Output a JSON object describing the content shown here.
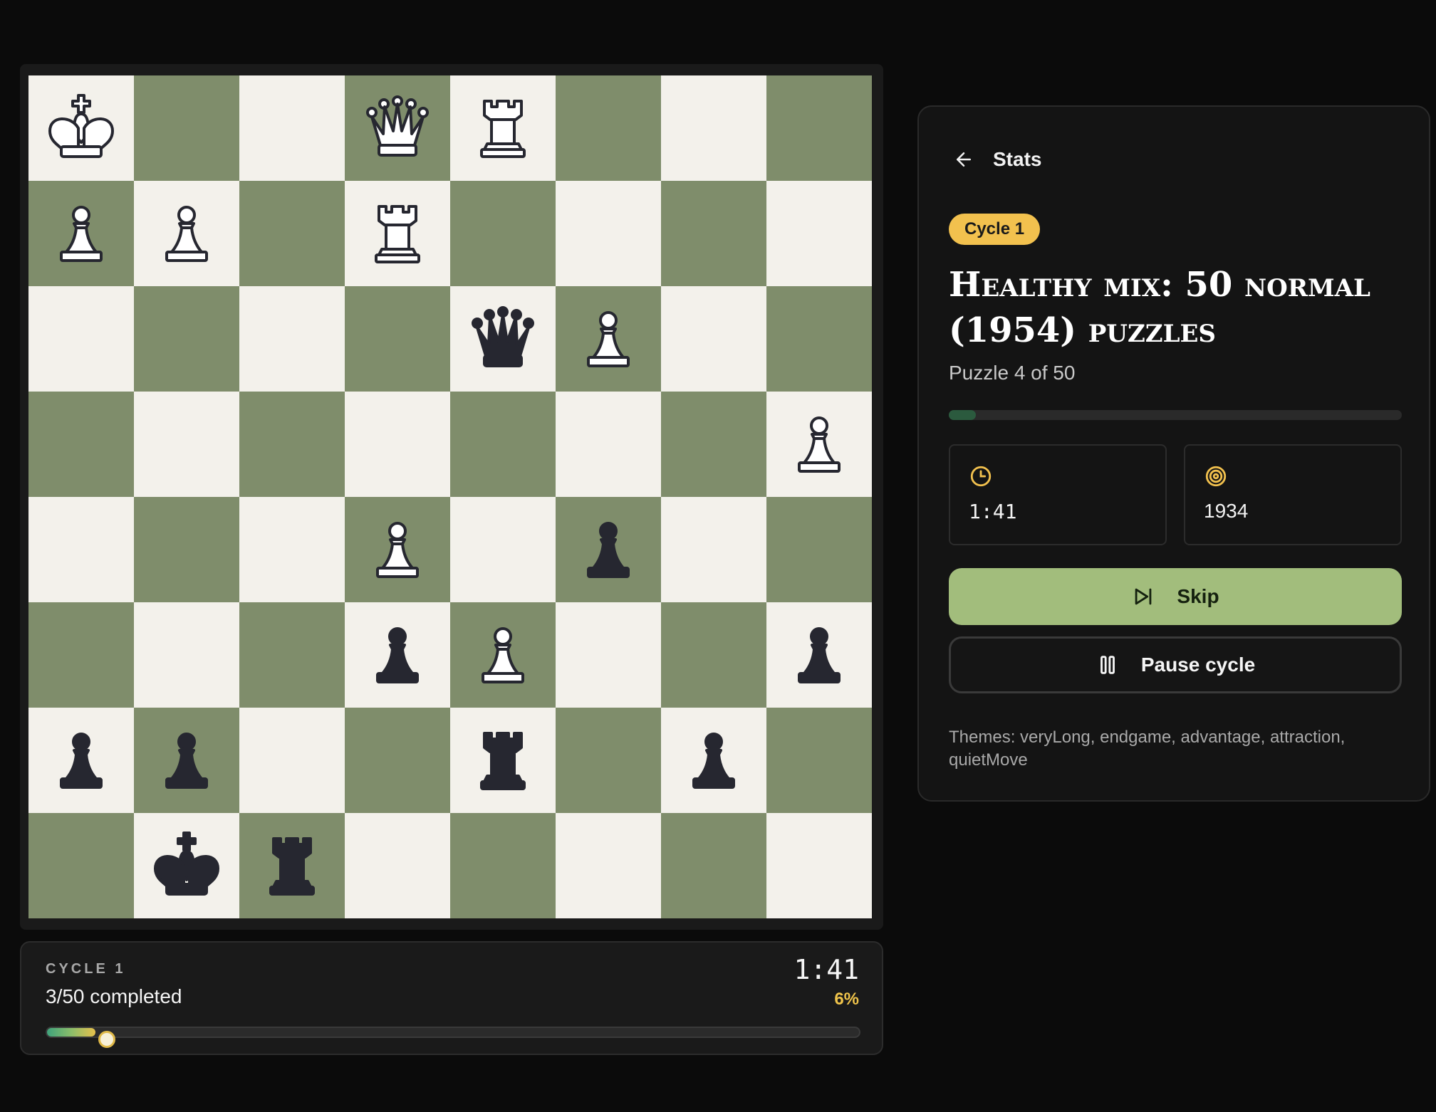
{
  "board": {
    "ranks": [
      [
        "wK",
        "",
        "",
        "wQ",
        "wR",
        "",
        "",
        ""
      ],
      [
        "wP",
        "wP",
        "",
        "wR",
        "",
        "",
        "",
        ""
      ],
      [
        "",
        "",
        "",
        "",
        "bQ",
        "wP",
        "",
        ""
      ],
      [
        "",
        "",
        "",
        "",
        "",
        "",
        "",
        "wP"
      ],
      [
        "",
        "",
        "",
        "wP",
        "",
        "bP",
        "",
        ""
      ],
      [
        "",
        "",
        "",
        "bP",
        "wP",
        "",
        "",
        "bP"
      ],
      [
        "bP",
        "bP",
        "",
        "",
        "bR",
        "",
        "bP",
        ""
      ],
      [
        "",
        "bK",
        "bR",
        "",
        "",
        "",
        "",
        ""
      ]
    ],
    "colors": {
      "light": "#f3f1eb",
      "dark": "#7f8d6b",
      "white_piece": "#ffffff",
      "black_piece": "#262730",
      "outline": "#262730"
    }
  },
  "cycle_card": {
    "label": "CYCLE 1",
    "completed": "3/50 completed",
    "time": "1:41",
    "percent_label": "6%",
    "progress": 0.06
  },
  "panel": {
    "back_icon": "arrow-left-icon",
    "back_label": "Stats",
    "badge": "Cycle 1",
    "title": "Healthy mix: 50 normal (1954) puzzles",
    "subtitle": "Puzzle 4 of 50",
    "puzzle_progress": 0.06,
    "stats": [
      {
        "icon": "clock-icon",
        "value": "1:41"
      },
      {
        "icon": "target-icon",
        "value": "1934"
      }
    ],
    "skip_label": "Skip",
    "skip_icon": "skip-forward-icon",
    "pause_label": "Pause cycle",
    "pause_icon": "pause-icon",
    "themes": "Themes: veryLong, endgame, advantage, attraction, quietMove",
    "accent": "#f2c14e",
    "skip_color": "#a2bd7c"
  }
}
